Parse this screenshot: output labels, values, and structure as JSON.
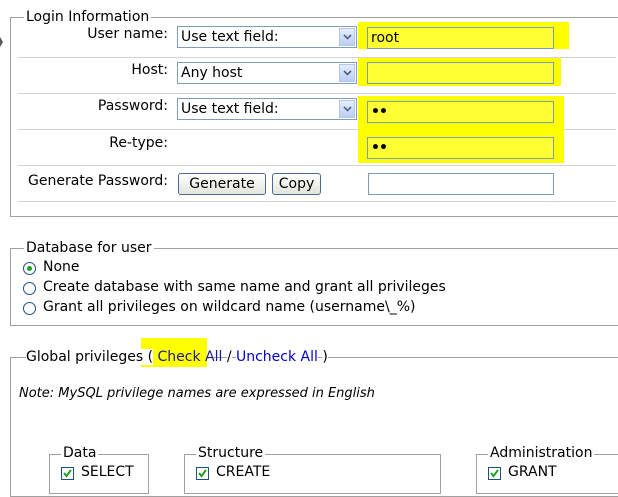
{
  "login": {
    "legend": "Login Information",
    "username_label": "User name:",
    "username_mode": "Use text field:",
    "username_value": "root",
    "host_label": "Host:",
    "host_mode": "Any host",
    "host_value": "",
    "password_label": "Password:",
    "password_mode": "Use text field:",
    "password_value": "••",
    "retype_label": "Re-type:",
    "retype_value": "••",
    "generate_label": "Generate Password:",
    "generate_button": "Generate",
    "copy_button": "Copy",
    "generated_value": ""
  },
  "database": {
    "legend": "Database for user",
    "options": [
      "None",
      "Create database with same name and grant all privileges",
      "Grant all privileges on wildcard name (username\\_%)"
    ],
    "selected_index": 0
  },
  "global": {
    "legend_prefix": "Global privileges (",
    "check_all": "Check All",
    "separator": "/",
    "uncheck_all": "Uncheck All",
    "legend_suffix": ")",
    "note": "Note: MySQL privilege names are expressed in English",
    "groups": {
      "data": {
        "legend": "Data",
        "first_item": "SELECT"
      },
      "structure": {
        "legend": "Structure",
        "first_item": "CREATE"
      },
      "administration": {
        "legend": "Administration",
        "first_item": "GRANT"
      }
    }
  },
  "colors": {
    "highlight": "#ffff00",
    "link": "#0000cc",
    "radio_dot": "#21a121"
  }
}
